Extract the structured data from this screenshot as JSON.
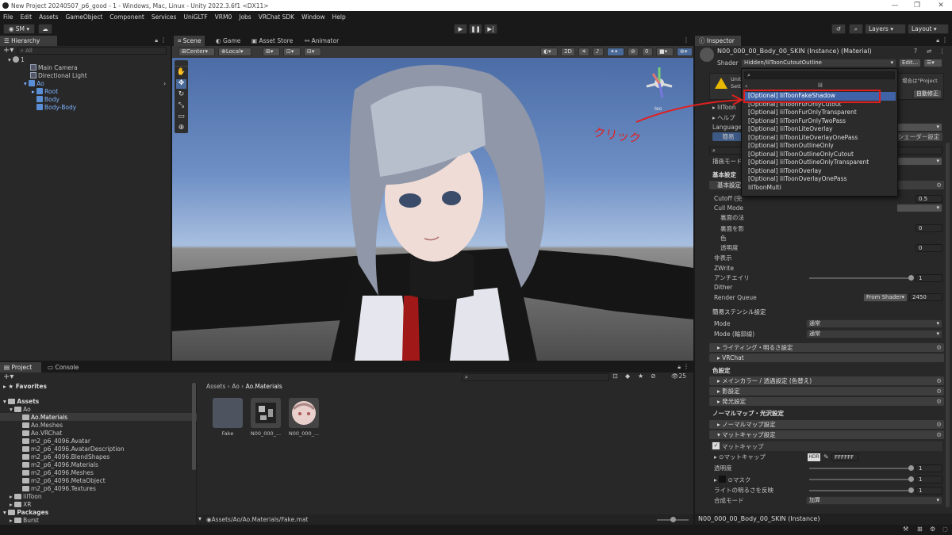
{
  "window": {
    "title": "New Project 20240507_p6_good - 1 - Windows, Mac, Linux - Unity 2022.3.6f1 <DX11>"
  },
  "menu": [
    "File",
    "Edit",
    "Assets",
    "GameObject",
    "Component",
    "Services",
    "UniGLTF",
    "VRM0",
    "Jobs",
    "VRChat SDK",
    "Window",
    "Help"
  ],
  "toolbar": {
    "account": "SM",
    "layers": "Layers",
    "layout": "Layout"
  },
  "hierarchy": {
    "tab": "Hierarchy",
    "search_placeholder": "All",
    "scene": "1",
    "items": [
      "Main Camera",
      "Directional Light",
      "Ao",
      "Root",
      "Body",
      "Body-Body"
    ]
  },
  "scene_tabs": [
    "Scene",
    "Game",
    "Asset Store",
    "Animator"
  ],
  "scene_toolbar": {
    "pivot": "Center",
    "space": "Local",
    "mode2d": "2D"
  },
  "gizmo": {
    "iso": "Iso"
  },
  "annotation": {
    "text": "クリック",
    "color": "#e02020"
  },
  "project": {
    "tabs": [
      "Project",
      "Console"
    ],
    "favorites": "Favorites",
    "assets": "Assets",
    "ao": "Ao",
    "folders": [
      "Ao.Materials",
      "Ao.Meshes",
      "Ao.VRChat",
      "m2_p6_4096.Avatar",
      "m2_p6_4096.AvatarDescription",
      "m2_p6_4096.BlendShapes",
      "m2_p6_4096.Materials",
      "m2_p6_4096.Meshes",
      "m2_p6_4096.MetaObject",
      "m2_p6_4096.Textures"
    ],
    "liltoon": "lilToon",
    "xr": "XR",
    "packages": "Packages",
    "burst": "Burst",
    "breadcrumb": [
      "Assets",
      "Ao",
      "Ao.Materials"
    ],
    "items": [
      "Fake",
      "N00_000_...",
      "N00_000_..."
    ],
    "count": "25",
    "path": "Assets/Ao/Ao.Materials/Fake.mat"
  },
  "inspector": {
    "tab": "Inspector",
    "title": "N00_000_00_Body_00_SKIN (Instance) (Material)",
    "shader_label": "Shader",
    "shader_value": "Hidden/lilToonCutoutOutline",
    "edit": "Edit...",
    "warn_1": "Unity",
    "warn_2": "Setti",
    "warn_tail": "場合は\"Project",
    "auto_fix": "自動修正",
    "liltoon": "lilToon",
    "help": "ヘルプ",
    "language": "Language",
    "simple": "簡易",
    "shader_setting": "シェーダー設定",
    "render_mode": "描画モード",
    "basic_title": "基本設定",
    "basic_section": "基本設定",
    "cutoff": "Cutoff (完",
    "cutoff_val": "0.5",
    "cull": "Cull Mode",
    "backface": "裏面の法",
    "backface2": "裏面を影",
    "color": "色",
    "alpha": "透明度",
    "zero1": "0",
    "zero2": "0",
    "hidden": "非表示",
    "zwrite": "ZWrite",
    "aa": "アンチエイリ",
    "one": "1",
    "dither": "Dither",
    "render_queue": "Render Queue",
    "from_shader": "From Shader",
    "queue_val": "2450",
    "stencil": "簡易ステンシル設定",
    "mode": "Mode",
    "mode_val": "通常",
    "mode_outline": "Mode (輪郭線)",
    "mode_outline_val": "通常",
    "lighting": "ライティング・明るさ設定",
    "vrchat": "VRChat",
    "color_title": "色設定",
    "main_color": "メインカラー / 透過設定 (色替え)",
    "shadow": "影設定",
    "emission": "発光設定",
    "normal_title": "ノーマルマップ・光沢設定",
    "normal": "ノーマルマップ設定",
    "matcap": "マットキャップ設定",
    "matcap_toggle": "マットキャップ",
    "matcap_tex": "マットキャップ",
    "hdr": "HDR",
    "hex": "FFFFFF",
    "opacity": "透明度",
    "mask": "マスク",
    "light_reflect": "ライトの明るさを反映",
    "blend": "合成モード",
    "blend_val": "加算",
    "bottom": "N00_000_00_Body_00_SKIN (Instance)"
  },
  "dropdown": {
    "crumb": "lil",
    "items": [
      "[Optional] lilToonFakeShadow",
      "[Optional] lilToonFurOnlyCutout",
      "[Optional] lilToonFurOnlyTransparent",
      "[Optional] lilToonFurOnlyTwoPass",
      "[Optional] lilToonLiteOverlay",
      "[Optional] lilToonLiteOverlayOnePass",
      "[Optional] lilToonOutlineOnly",
      "[Optional] lilToonOutlineOnlyCutout",
      "[Optional] lilToonOutlineOnlyTransparent",
      "[Optional] lilToonOverlay",
      "[Optional] lilToonOverlayOnePass",
      "lilToonMulti"
    ]
  }
}
